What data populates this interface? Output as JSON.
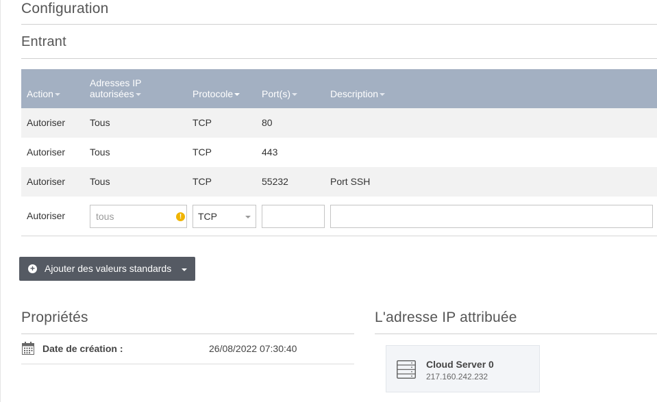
{
  "config_title": "Configuration",
  "inbound_title": "Entrant",
  "table": {
    "headers": [
      "Action",
      "Adresses IP",
      "autorisées",
      "Protocole",
      "Port(s)",
      "Description"
    ],
    "rows": [
      [
        "Autoriser",
        "Tous",
        "TCP",
        "80",
        ""
      ],
      [
        "Autoriser",
        "Tous",
        "TCP",
        "443",
        ""
      ],
      [
        "Autoriser",
        "Tous",
        "TCP",
        "55232",
        "Port SSH"
      ]
    ]
  },
  "new_rule": {
    "action": "Autoriser",
    "ip_placeholder": "tous",
    "protocol": "TCP",
    "port_value": "",
    "description_value": ""
  },
  "add_defaults_button": "Ajouter des valeurs standards",
  "properties": {
    "title": "Propriétés",
    "creation_label": "Date de création :",
    "creation_value": "26/08/2022 07:30:40"
  },
  "assigned_ip": {
    "title": "L'adresse IP attribuée",
    "server_name": "Cloud Server 0",
    "ip": "217.160.242.232"
  },
  "colors": {
    "table_header": "#a3b0c2",
    "button": "#555a63",
    "warning": "#f0b400"
  },
  "icons": {
    "warning": "exclamation-circle-icon",
    "add": "plus-circle-icon",
    "calendar": "calendar-icon",
    "server": "server-icon"
  }
}
